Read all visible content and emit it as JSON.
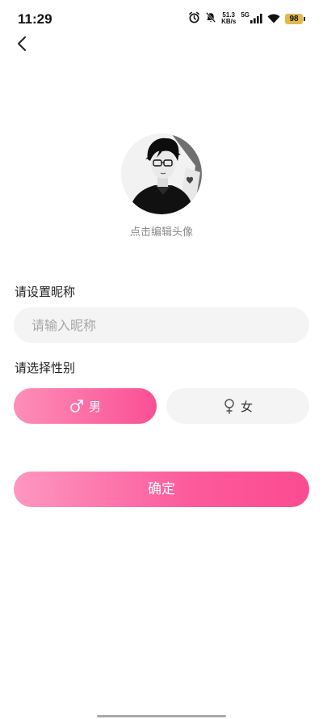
{
  "status_bar": {
    "time": "11:29",
    "net_speed_value": "51.3",
    "net_speed_unit": "KB/s",
    "network_type": "5G",
    "battery_level": "98",
    "icons": [
      "alarm-icon",
      "bell-off-icon",
      "signal-icon",
      "wifi-icon",
      "battery-icon"
    ]
  },
  "nav": {
    "back_icon": "chevron-left-icon"
  },
  "avatar": {
    "hint": "点击编辑头像"
  },
  "nickname": {
    "label": "请设置昵称",
    "placeholder": "请输入昵称",
    "value": ""
  },
  "gender": {
    "label": "请选择性别",
    "options": [
      {
        "symbol": "male-icon",
        "label": "男",
        "selected": true
      },
      {
        "symbol": "female-icon",
        "label": "女",
        "selected": false
      }
    ]
  },
  "confirm_label": "确定",
  "colors": {
    "accent_start": "#fc8fb8",
    "accent_end": "#fb4f94",
    "input_bg": "#f4f4f4",
    "hint_text": "#8a8a8a"
  }
}
